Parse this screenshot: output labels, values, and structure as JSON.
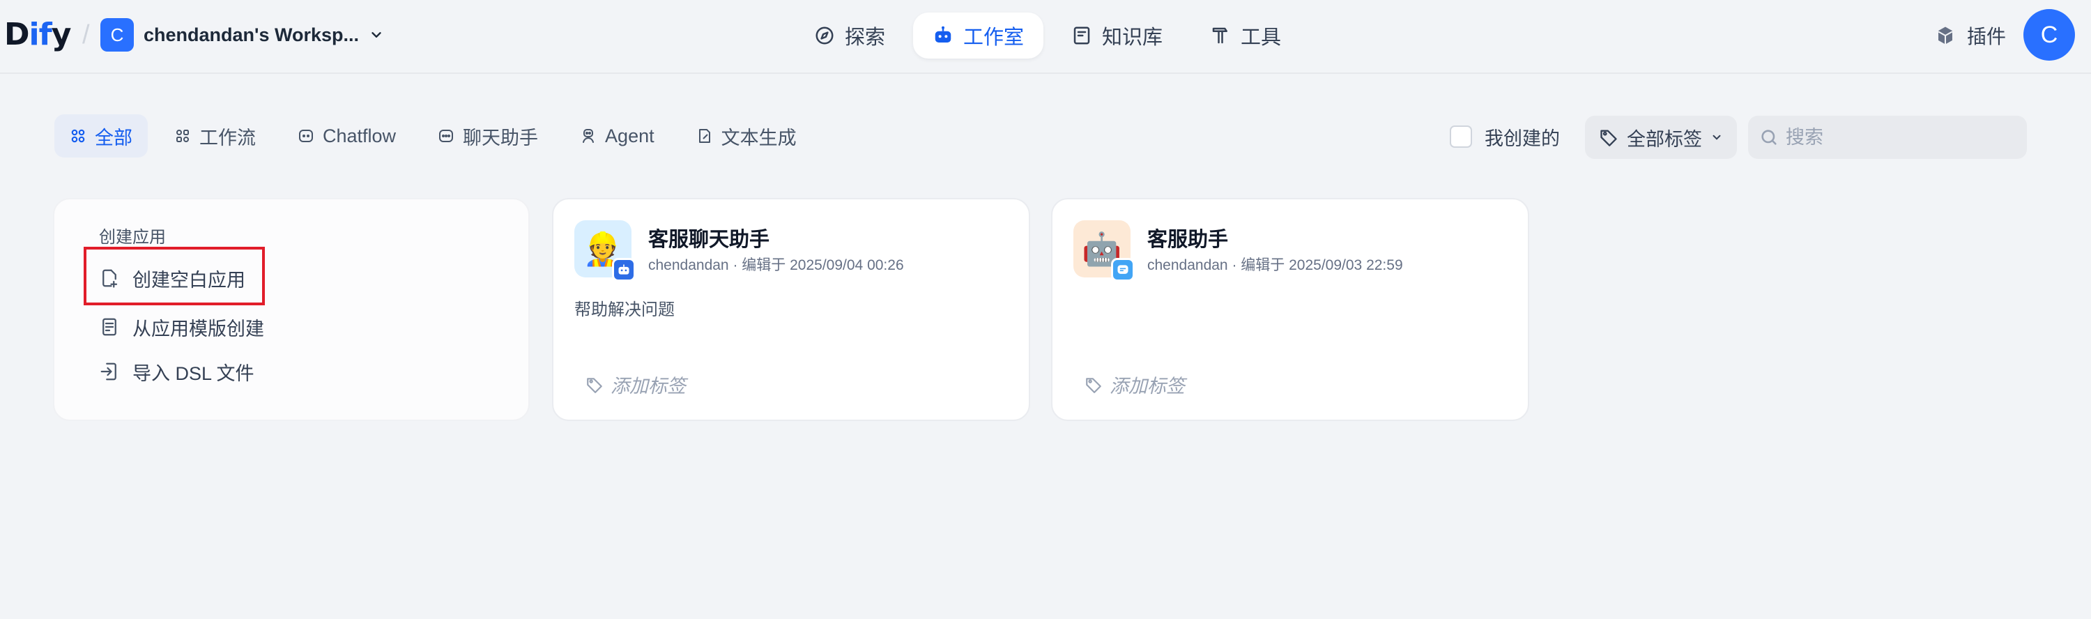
{
  "header": {
    "logo_prefix": "D",
    "logo_accent": "if",
    "logo_suffix": "y",
    "separator": "/",
    "workspace_initial": "C",
    "workspace_name": "chendandan's Worksp...",
    "nav": [
      {
        "label": "探索",
        "icon": "compass-icon",
        "active": false
      },
      {
        "label": "工作室",
        "icon": "robot-icon",
        "active": true
      },
      {
        "label": "知识库",
        "icon": "book-icon",
        "active": false
      },
      {
        "label": "工具",
        "icon": "hammer-icon",
        "active": false
      }
    ],
    "plugin_label": "插件",
    "user_initial": "C"
  },
  "filters": {
    "tabs": [
      {
        "label": "全部",
        "icon": "grid-icon",
        "active": true
      },
      {
        "label": "工作流",
        "icon": "workflow-icon",
        "active": false
      },
      {
        "label": "Chatflow",
        "icon": "chatflow-icon",
        "active": false
      },
      {
        "label": "聊天助手",
        "icon": "chat-bubble-icon",
        "active": false
      },
      {
        "label": "Agent",
        "icon": "agent-icon",
        "active": false
      },
      {
        "label": "文本生成",
        "icon": "document-icon",
        "active": false
      }
    ],
    "mine_label": "我创建的",
    "tag_filter_label": "全部标签",
    "search_placeholder": "搜索"
  },
  "create_card": {
    "title": "创建应用",
    "items": [
      {
        "label": "创建空白应用",
        "icon": "blank-file-icon"
      },
      {
        "label": "从应用模版创建",
        "icon": "template-icon"
      },
      {
        "label": "导入 DSL 文件",
        "icon": "import-icon"
      }
    ]
  },
  "apps": [
    {
      "name": "客服聊天助手",
      "icon_emoji": "👷",
      "author": "chendandan",
      "edited": "· 编辑于 2025/09/04 00:26",
      "description": "帮助解决问题",
      "add_tag_label": "添加标签",
      "type_badge": "agent-badge-icon"
    },
    {
      "name": "客服助手",
      "icon_emoji": "🤖",
      "author": "chendandan",
      "edited": "· 编辑于 2025/09/03 22:59",
      "description": "",
      "add_tag_label": "添加标签",
      "type_badge": "chat-badge-icon"
    }
  ],
  "colors": {
    "accent": "#155eef",
    "background": "#f2f4f7",
    "highlight_box": "#e11d2a"
  }
}
